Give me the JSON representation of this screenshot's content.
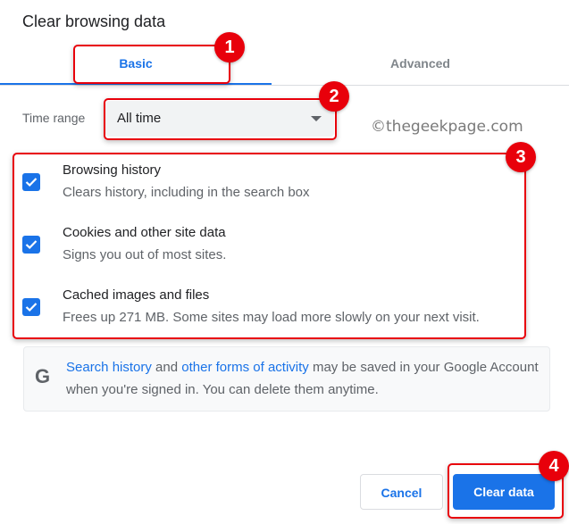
{
  "dialog": {
    "title": "Clear browsing data",
    "tabs": [
      {
        "label": "Basic",
        "active": true
      },
      {
        "label": "Advanced",
        "active": false
      }
    ],
    "time_range": {
      "label": "Time range",
      "selected": "All time"
    },
    "watermark": "©thegeekpage.com",
    "items": [
      {
        "label": "Browsing history",
        "description": "Clears history, including in the search box",
        "checked": true
      },
      {
        "label": "Cookies and other site data",
        "description": "Signs you out of most sites.",
        "checked": true
      },
      {
        "label": "Cached images and files",
        "description": "Frees up 271 MB. Some sites may load more slowly on your next visit.",
        "checked": true
      }
    ],
    "info": {
      "icon": "google-g-icon",
      "link1": "Search history",
      "text1": " and ",
      "link2": "other forms of activity",
      "text2": " may be saved in your Google Account when you're signed in. You can delete them anytime."
    },
    "buttons": {
      "cancel": "Cancel",
      "clear": "Clear data"
    }
  },
  "annotations": [
    "1",
    "2",
    "3",
    "4"
  ],
  "colors": {
    "accent": "#1a73e8",
    "annotation": "#e8000b"
  }
}
